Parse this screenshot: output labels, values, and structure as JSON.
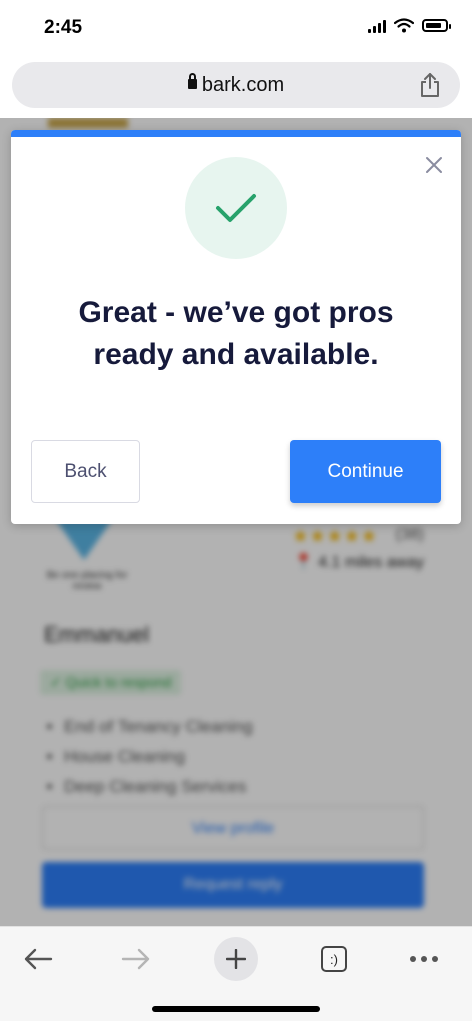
{
  "status_bar": {
    "time": "2:45"
  },
  "browser": {
    "url": "bark.com",
    "tab_count": ":)"
  },
  "modal": {
    "headline": "Great - we’ve got pros ready and available.",
    "back_label": "Back",
    "continue_label": "Continue",
    "accent_color": "#2d7ff9",
    "success_color": "#27a26b"
  },
  "background_page": {
    "name": "Emmanuel",
    "badge_text": "Be one\nplacing for review",
    "rating_count": "(38)",
    "distance": "4.1 miles away",
    "quick_tag": "Quick to respond",
    "services": [
      "End of Tenancy Cleaning",
      "House Cleaning",
      "Deep Cleaning Services"
    ],
    "view_profile_label": "View profile",
    "request_reply_label": "Request reply"
  },
  "icons": [
    "lock-icon",
    "share-icon",
    "close-icon",
    "checkmark-icon",
    "back-arrow-icon",
    "forward-arrow-icon",
    "plus-icon",
    "tabs-icon",
    "more-icon"
  ]
}
